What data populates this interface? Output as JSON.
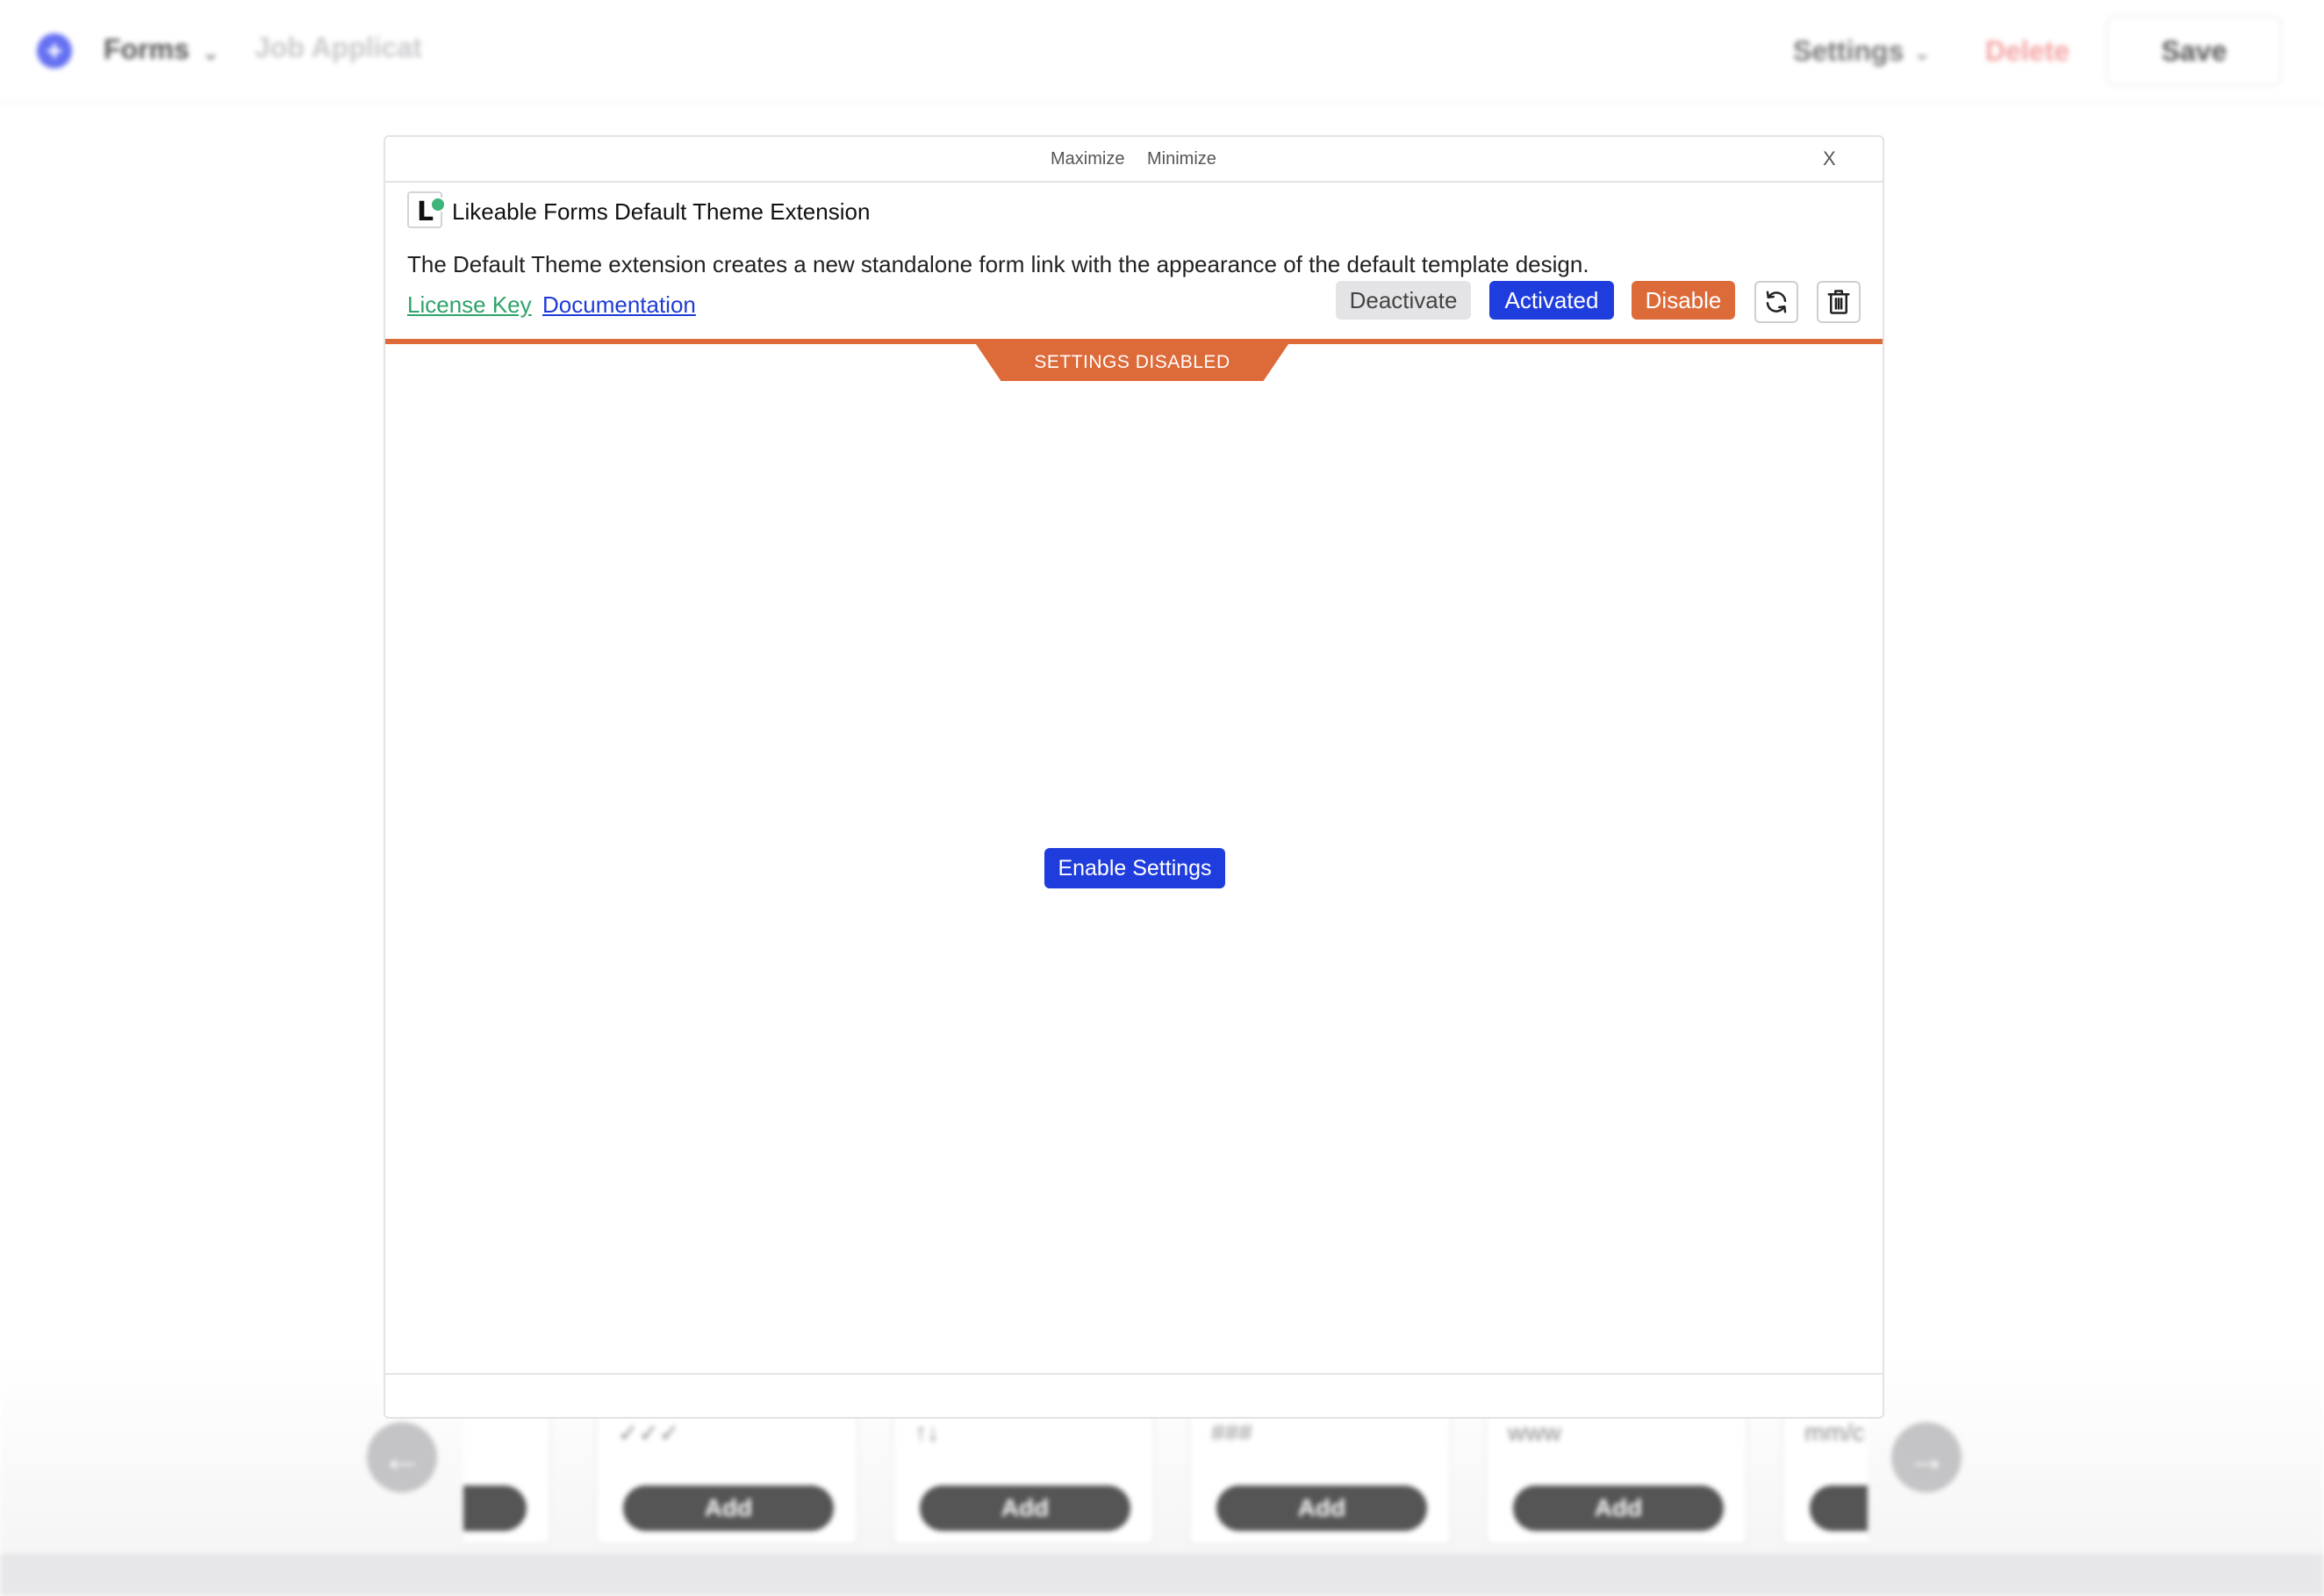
{
  "app": {
    "forms_label": "Forms",
    "form_title": "Job Applicat",
    "settings_label": "Settings",
    "delete_label": "Delete",
    "save_label": "Save"
  },
  "modal": {
    "maximize_label": "Maximize",
    "minimize_label": "Minimize",
    "close_label": "X",
    "extension": {
      "icon_letter": "L",
      "title": "Likeable Forms Default Theme Extension",
      "description": "The Default Theme extension creates a new standalone form link with the appearance of the default template design.",
      "license_link": "License Key",
      "docs_link": "Documentation"
    },
    "buttons": {
      "deactivate": "Deactivate",
      "activated": "Activated",
      "disable": "Disable"
    },
    "status_banner": "SETTINGS DISABLED",
    "enable_button": "Enable Settings"
  },
  "tiles": [
    {
      "symbol": "",
      "add_label": ""
    },
    {
      "symbol": "✓✓✓",
      "add_label": "Add"
    },
    {
      "symbol": "↑↓",
      "add_label": "Add"
    },
    {
      "symbol": "###",
      "add_label": "Add"
    },
    {
      "symbol": "www",
      "add_label": "Add"
    },
    {
      "symbol": "mm/c",
      "add_label": ""
    }
  ],
  "colors": {
    "accent_blue": "#1f3ddc",
    "accent_orange": "#dd6a39",
    "link_green": "#2fa36a"
  }
}
